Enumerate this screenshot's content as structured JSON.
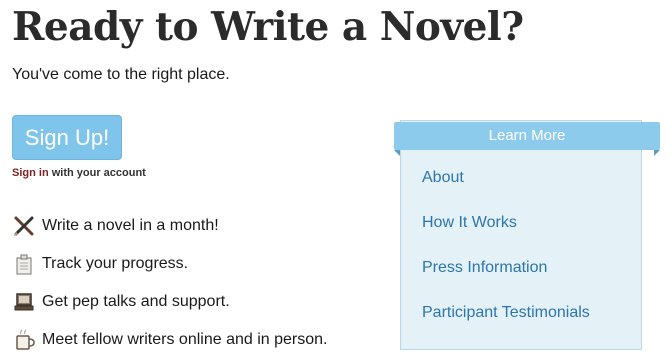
{
  "header": {
    "title": "Ready to Write a Novel?",
    "subtitle": "You've come to the right place."
  },
  "signup": {
    "button_label": "Sign Up!",
    "signin_link": "Sign in",
    "signin_suffix": " with your account"
  },
  "features": [
    {
      "icon": "pen-pencil-icon",
      "text": "Write a novel in a month!"
    },
    {
      "icon": "notepad-icon",
      "text": "Track your progress."
    },
    {
      "icon": "laptop-icon",
      "text": "Get pep talks and support."
    },
    {
      "icon": "coffee-mug-icon",
      "text": "Meet fellow writers online and in person."
    }
  ],
  "learn_more": {
    "title": "Learn More",
    "links": [
      "About",
      "How It Works",
      "Press Information",
      "Participant Testimonials"
    ]
  },
  "colors": {
    "button": "#7fc4ea",
    "banner": "#8dcbec",
    "panel": "#e4f1f6",
    "link": "#2b76ad",
    "signin": "#7a2424"
  }
}
